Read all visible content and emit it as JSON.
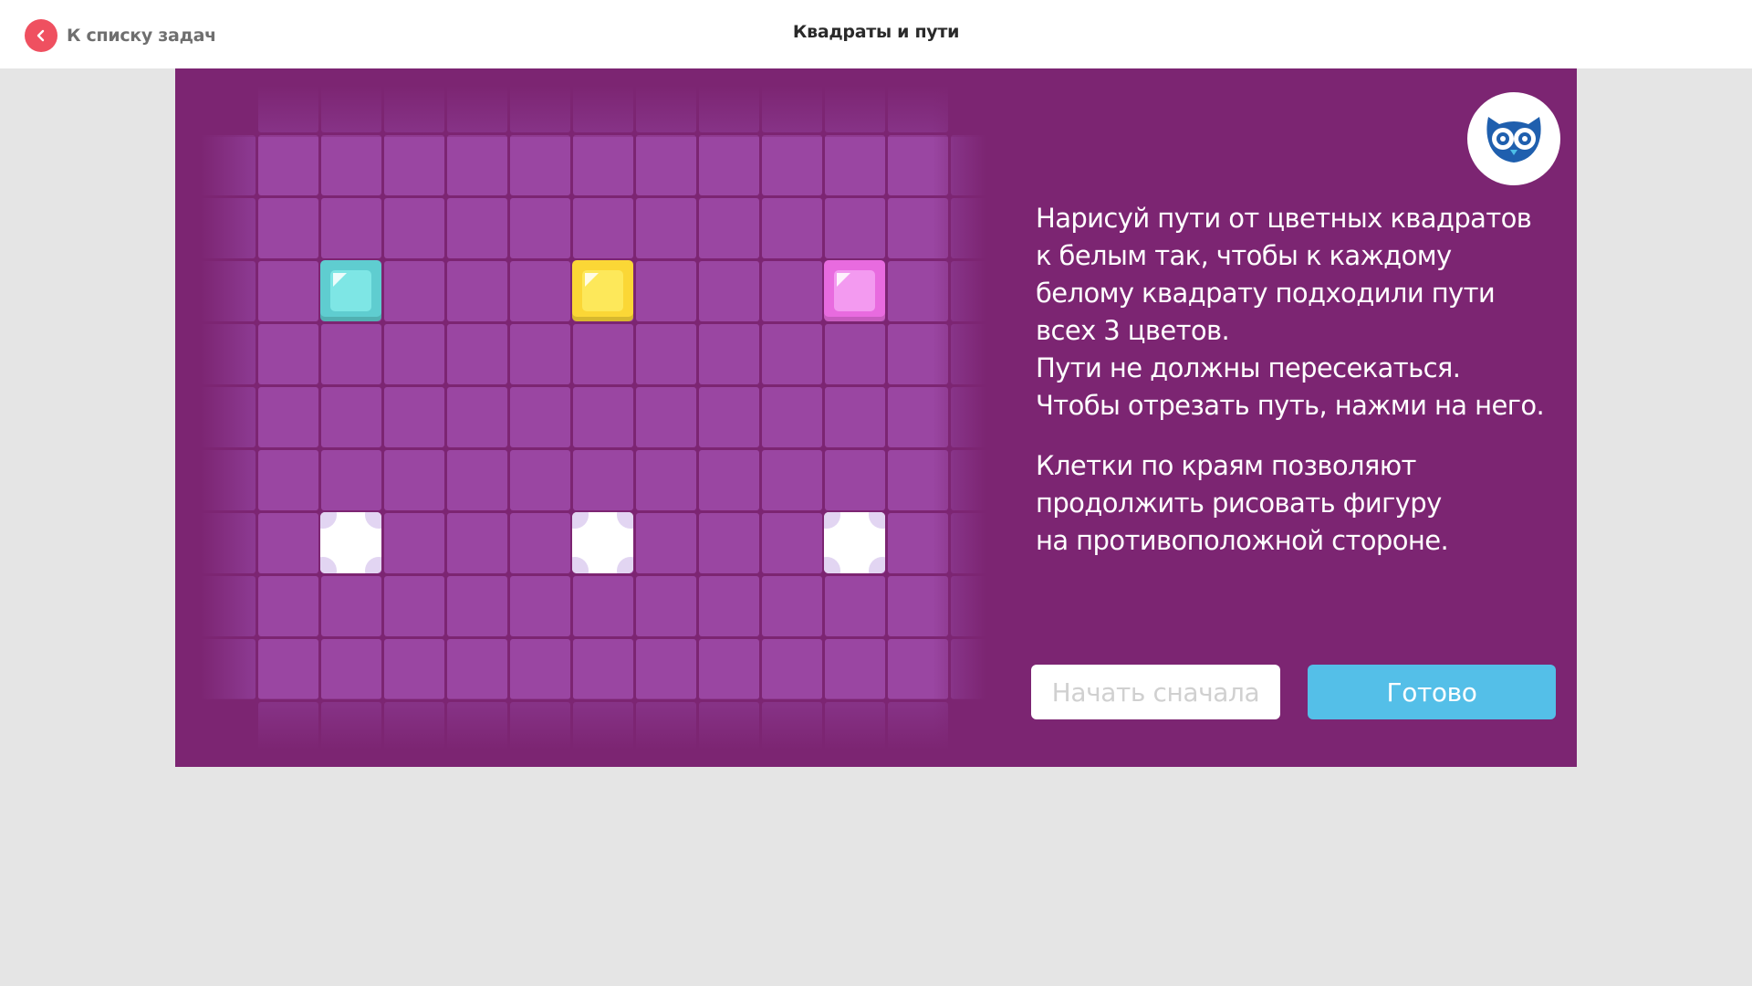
{
  "header": {
    "back_label": "К списку задач",
    "title": "Квадраты и пути"
  },
  "board": {
    "columns": 11,
    "rows": 9,
    "sources": [
      {
        "col": 1,
        "row": 2,
        "color": "cyan",
        "outer": "#5fcdd0",
        "inner": "#7ee6e5"
      },
      {
        "col": 5,
        "row": 2,
        "color": "yellow",
        "outer": "#fbd736",
        "inner": "#fde85a"
      },
      {
        "col": 9,
        "row": 2,
        "color": "pink",
        "outer": "#e86bdf",
        "inner": "#f39af0"
      }
    ],
    "targets": [
      {
        "col": 1,
        "row": 6
      },
      {
        "col": 5,
        "row": 6
      },
      {
        "col": 9,
        "row": 6
      }
    ]
  },
  "instructions": {
    "paragraph1": [
      "Нарисуй пути от цветных квадратов",
      "к белым так, чтобы к каждому",
      "белому квадрату подходили пути",
      "всех 3 цветов.",
      "Пути не должны пересекаться.",
      "Чтобы отрезать путь, нажми на него."
    ],
    "paragraph2": [
      "Клетки по краям позволяют",
      "продолжить рисовать фигуру",
      "на противоположной стороне."
    ]
  },
  "buttons": {
    "restart_label": "Начать сначала",
    "done_label": "Готово"
  },
  "colors": {
    "panel_bg": "#7c2572",
    "cell": "#9a46a2",
    "accent_button": "#54bfe8",
    "back_button": "#ef5060",
    "owl_blue": "#1f5fae"
  }
}
